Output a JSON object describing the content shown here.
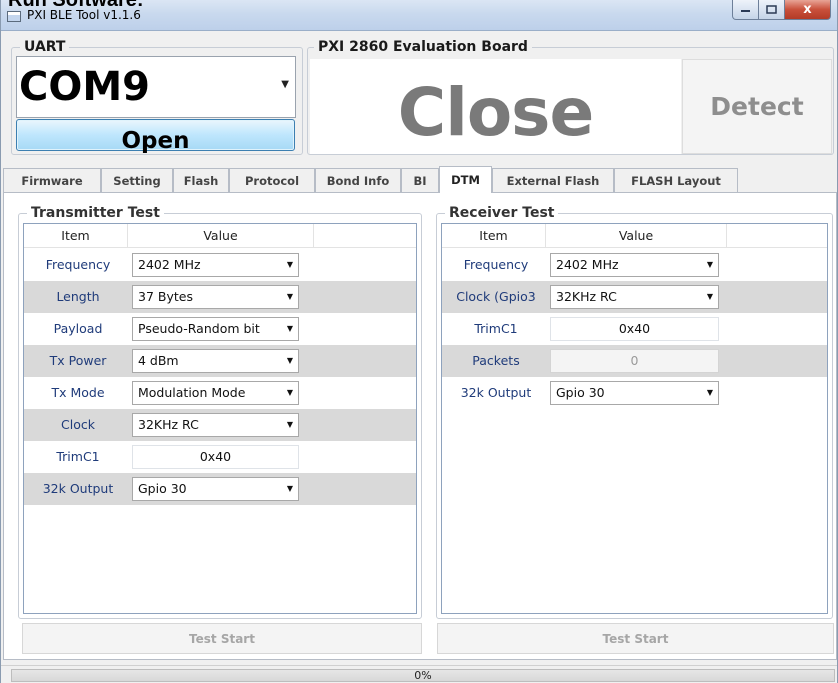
{
  "page_heading": "Run Software:",
  "window": {
    "title": "PXI BLE Tool v1.1.6",
    "controls": {
      "minimize_icon": "minimize-icon",
      "maximize_icon": "maximize-icon",
      "close_label": "x"
    }
  },
  "uart": {
    "group_label": "UART",
    "port_value": "COM9",
    "open_label": "Open"
  },
  "board": {
    "group_label": "PXI 2860 Evaluation Board",
    "status_text": "Close",
    "detect_label": "Detect"
  },
  "tabs": [
    {
      "label": "Firmware"
    },
    {
      "label": "Setting"
    },
    {
      "label": "Flash"
    },
    {
      "label": "Protocol"
    },
    {
      "label": "Bond Info"
    },
    {
      "label": "BI"
    },
    {
      "label": "DTM",
      "active": true
    },
    {
      "label": "External Flash"
    },
    {
      "label": "FLASH Layout"
    }
  ],
  "transmitter": {
    "group_label": "Transmitter Test",
    "columns": {
      "item": "Item",
      "value": "Value"
    },
    "rows": [
      {
        "label": "Frequency",
        "value": "2402 MHz",
        "control": "combo"
      },
      {
        "label": "Length",
        "value": "37 Bytes",
        "control": "combo"
      },
      {
        "label": "Payload",
        "value": "Pseudo-Random bit",
        "control": "combo"
      },
      {
        "label": "Tx Power",
        "value": "4 dBm",
        "control": "combo"
      },
      {
        "label": "Tx Mode",
        "value": "Modulation Mode",
        "control": "combo"
      },
      {
        "label": "Clock",
        "value": "32KHz RC",
        "control": "combo"
      },
      {
        "label": "TrimC1",
        "value": "0x40",
        "control": "text"
      },
      {
        "label": "32k Output",
        "value": "Gpio 30",
        "control": "combo"
      }
    ],
    "start_label": "Test Start"
  },
  "receiver": {
    "group_label": "Receiver Test",
    "columns": {
      "item": "Item",
      "value": "Value"
    },
    "rows": [
      {
        "label": "Frequency",
        "value": "2402 MHz",
        "control": "combo"
      },
      {
        "label": "Clock (Gpio3",
        "value": "32KHz RC",
        "control": "combo"
      },
      {
        "label": "TrimC1",
        "value": "0x40",
        "control": "text"
      },
      {
        "label": "Packets",
        "value": "0",
        "control": "text-disabled"
      },
      {
        "label": "32k Output",
        "value": "Gpio 30",
        "control": "combo"
      }
    ],
    "start_label": "Test Start"
  },
  "progress": {
    "text": "0%",
    "fraction": 0
  },
  "colors": {
    "accent": "#3c7fb1",
    "label_blue": "#1f3b7a",
    "status_gray": "#7a7a7a"
  }
}
